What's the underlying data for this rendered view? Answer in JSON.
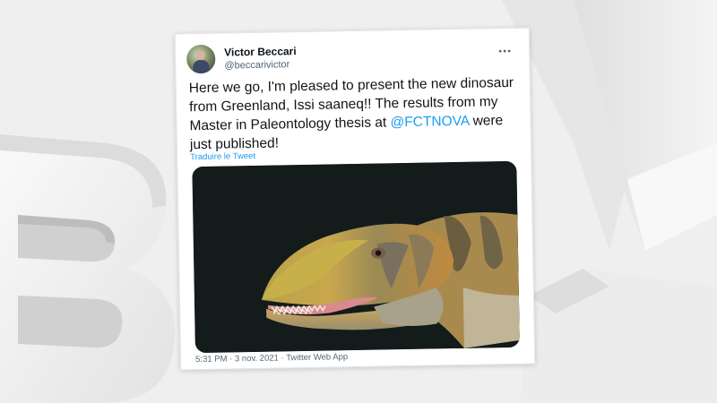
{
  "tweet": {
    "author_name": "Victor Beccari",
    "author_handle": "@beccarivictor",
    "more_icon": "more-options-icon",
    "text_before": "Here we go, I'm pleased to present the new dinosaur from Greenland, Issi saaneq!! The results from my Master in Paleontology thesis at ",
    "mention": "@FCTNOVA",
    "text_after": " were just published!",
    "translate_label": "Traduire le Tweet",
    "time": "5:31 PM",
    "separator_1": " · ",
    "date": "3 nov. 2021",
    "separator_2": " · ",
    "source": "Twitter Web App"
  },
  "watermark": {
    "brand": "BFM"
  },
  "colors": {
    "accent": "#1d9bf0",
    "text": "#0f1419",
    "muted": "#536471",
    "background": "#efefef"
  }
}
